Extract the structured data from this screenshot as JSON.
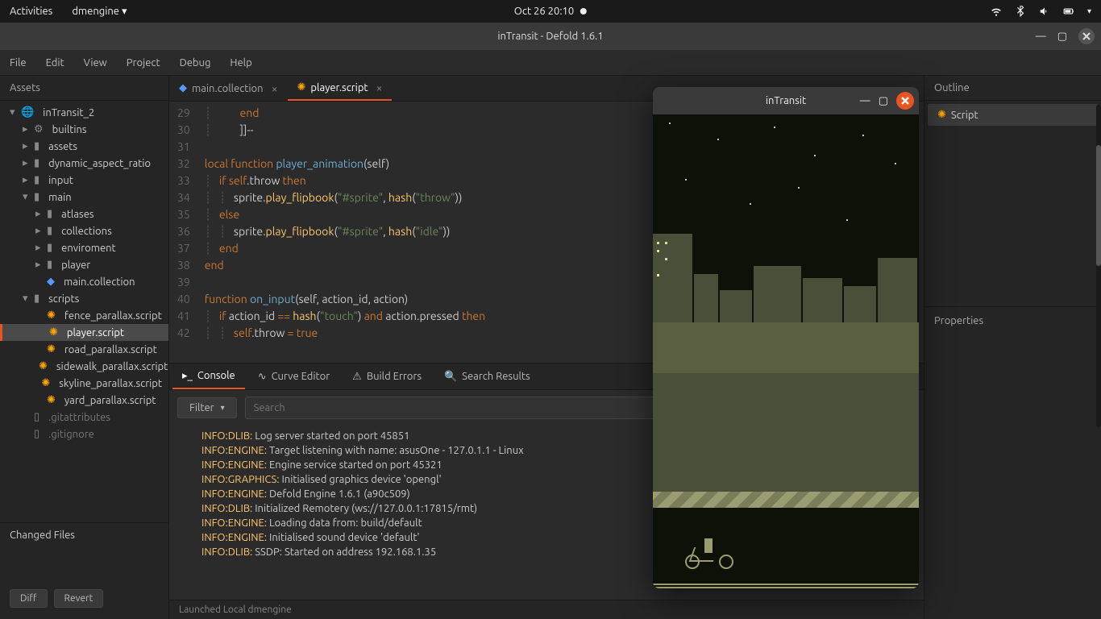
{
  "gnome": {
    "activities": "Activities",
    "app": "dmengine",
    "datetime": "Oct 26  20:10"
  },
  "window": {
    "title": "inTransit - Defold 1.6.1"
  },
  "menu": {
    "file": "File",
    "edit": "Edit",
    "view": "View",
    "project": "Project",
    "debug": "Debug",
    "help": "Help"
  },
  "panels": {
    "assets": "Assets",
    "changed": "Changed Files",
    "outline": "Outline",
    "properties": "Properties"
  },
  "tree": {
    "root": "inTransit_2",
    "builtins": "builtins",
    "assets": "assets",
    "dynamic_aspect_ratio": "dynamic_aspect_ratio",
    "input": "input",
    "main": "main",
    "atlases": "atlases",
    "collections": "collections",
    "enviroment": "enviroment",
    "player": "player",
    "main_collection": "main.collection",
    "scripts": "scripts",
    "fence": "fence_parallax.script",
    "player_script": "player.script",
    "road": "road_parallax.script",
    "sidewalk": "sidewalk_parallax.script",
    "skyline": "skyline_parallax.script",
    "yard": "yard_parallax.script",
    "gitattributes": ".gitattributes",
    "gitignore": ".gitignore"
  },
  "buttons": {
    "diff": "Diff",
    "revert": "Revert",
    "filter": "Filter"
  },
  "tabs": {
    "tab1": "main.collection",
    "tab2": "player.script"
  },
  "bottom_tabs": {
    "console": "Console",
    "curve": "Curve Editor",
    "build": "Build Errors",
    "search": "Search Results"
  },
  "search": {
    "placeholder": "Search"
  },
  "outline_item": "Script",
  "statusbar": "Launched Local dmengine",
  "game": {
    "title": "inTransit"
  },
  "code": {
    "lines": [
      "29",
      "30",
      "31",
      "32",
      "33",
      "34",
      "35",
      "36",
      "37",
      "38",
      "39",
      "40",
      "41",
      "42"
    ],
    "l29": "        end",
    "l30": "        ]]--",
    "l32a": "local",
    "l32b": "function",
    "l32c": "player_animation",
    "l32d": "(self)",
    "l33a": "if",
    "l33b": "self",
    "l33c": ".throw",
    "l33d": "then",
    "l34a": "sprite.",
    "l34b": "play_flipbook",
    "l34c": "(",
    "l34d": "\"#sprite\"",
    "l34e": ", ",
    "l34f": "hash",
    "l34g": "(",
    "l34h": "\"throw\"",
    "l34i": "))",
    "l35": "else",
    "l36h": "\"idle\"",
    "l37": "end",
    "l38": "end",
    "l40a": "function",
    "l40b": "on_input",
    "l40c": "(self, action_id, action)",
    "l41a": "if",
    "l41b": " action_id ",
    "l41c": "==",
    "l41d": "hash",
    "l41e": "(",
    "l41f": "\"touch\"",
    "l41g": ") ",
    "l41h": "and",
    "l41i": " action.pressed ",
    "l41j": "then",
    "l42a": "self",
    "l42b": ".throw ",
    "l42c": "=",
    "l42d": "true"
  },
  "console": {
    "lines": [
      {
        "tag": "INFO:DLIB:",
        "msg": " Log server started on port 45851"
      },
      {
        "tag": "INFO:ENGINE:",
        "msg": " Target listening with name: asusOne - 127.0.1.1 - Linux"
      },
      {
        "tag": "INFO:ENGINE:",
        "msg": " Engine service started on port 45321"
      },
      {
        "tag": "INFO:GRAPHICS:",
        "msg": " Initialised graphics device 'opengl'"
      },
      {
        "tag": "INFO:ENGINE:",
        "msg": " Defold Engine 1.6.1 (a90c509)"
      },
      {
        "tag": "INFO:DLIB:",
        "msg": " Initialized Remotery (ws://127.0.0.1:17815/rmt)"
      },
      {
        "tag": "INFO:ENGINE:",
        "msg": " Loading data from: build/default"
      },
      {
        "tag": "INFO:ENGINE:",
        "msg": " Initialised sound device 'default'"
      },
      {
        "tag": "INFO:DLIB:",
        "msg": " SSDP: Started on address 192.168.1.35"
      }
    ]
  }
}
